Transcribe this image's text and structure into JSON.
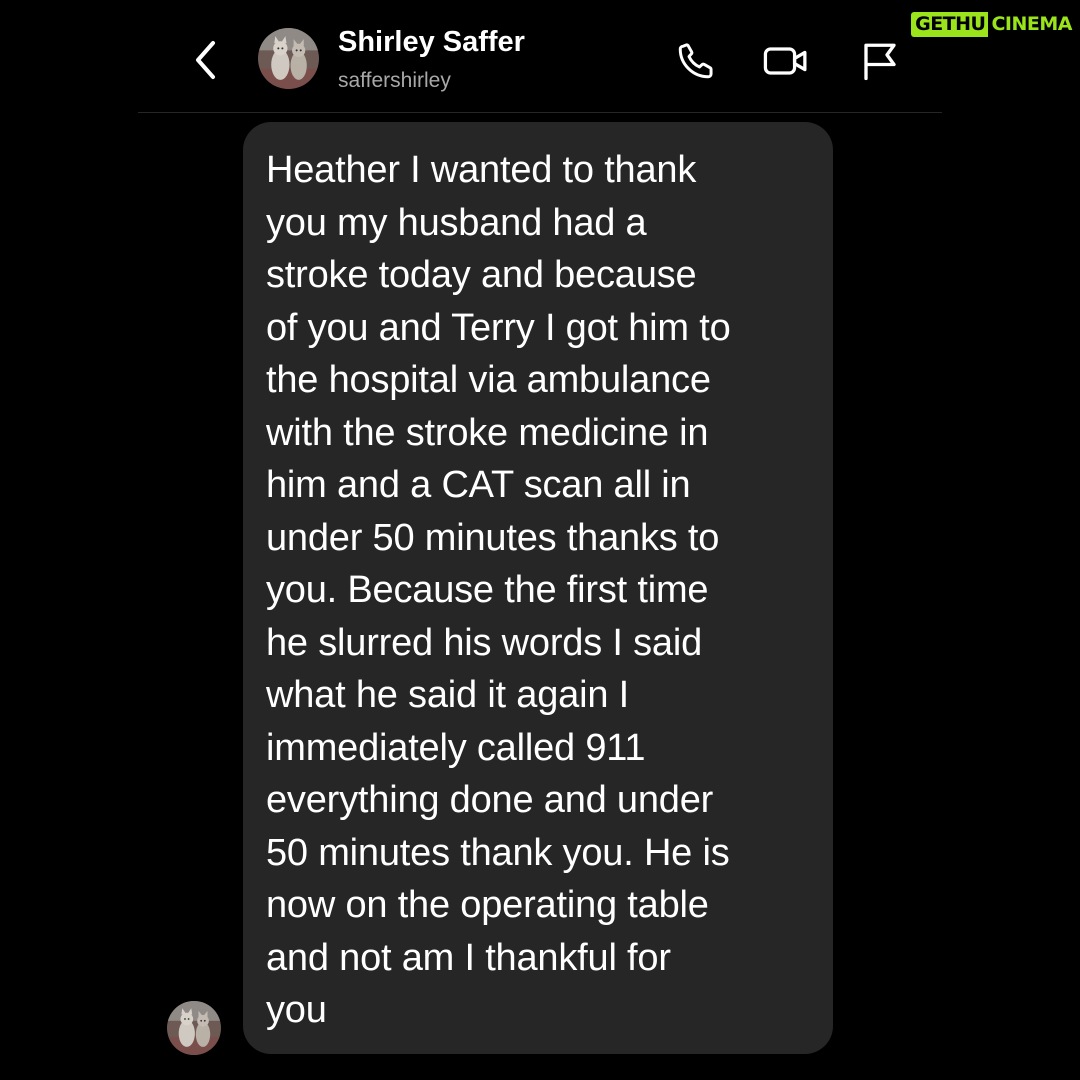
{
  "watermark": {
    "left": "GETHU",
    "right": "CINEMA",
    "accent_color": "#9be31a"
  },
  "header": {
    "back_icon": "chevron-left-icon",
    "contact_name": "Shirley Saffer",
    "contact_handle": "saffershirley",
    "actions": [
      {
        "name": "call",
        "icon": "phone-icon"
      },
      {
        "name": "video",
        "icon": "video-camera-icon"
      },
      {
        "name": "report",
        "icon": "flag-icon"
      }
    ]
  },
  "thread": {
    "messages": [
      {
        "sender": "Shirley Saffer",
        "lines": [
          "Heather I wanted to thank",
          "you my husband had a",
          "stroke today and because",
          "of you and Terry I got him to",
          "the hospital via ambulance",
          "with the stroke medicine in",
          "him and a CAT scan all in",
          "under 50 minutes thanks to",
          "you. Because the first time",
          "he slurred his words I said",
          "what he said it again I",
          "immediately called 911",
          "everything done and under",
          "50 minutes thank you. He is",
          "now on the operating table",
          "and not am I thankful for",
          "you"
        ]
      }
    ]
  },
  "colors": {
    "background": "#000000",
    "bubble": "#262626",
    "text_primary": "#ffffff",
    "text_secondary": "#a8a8a8"
  }
}
